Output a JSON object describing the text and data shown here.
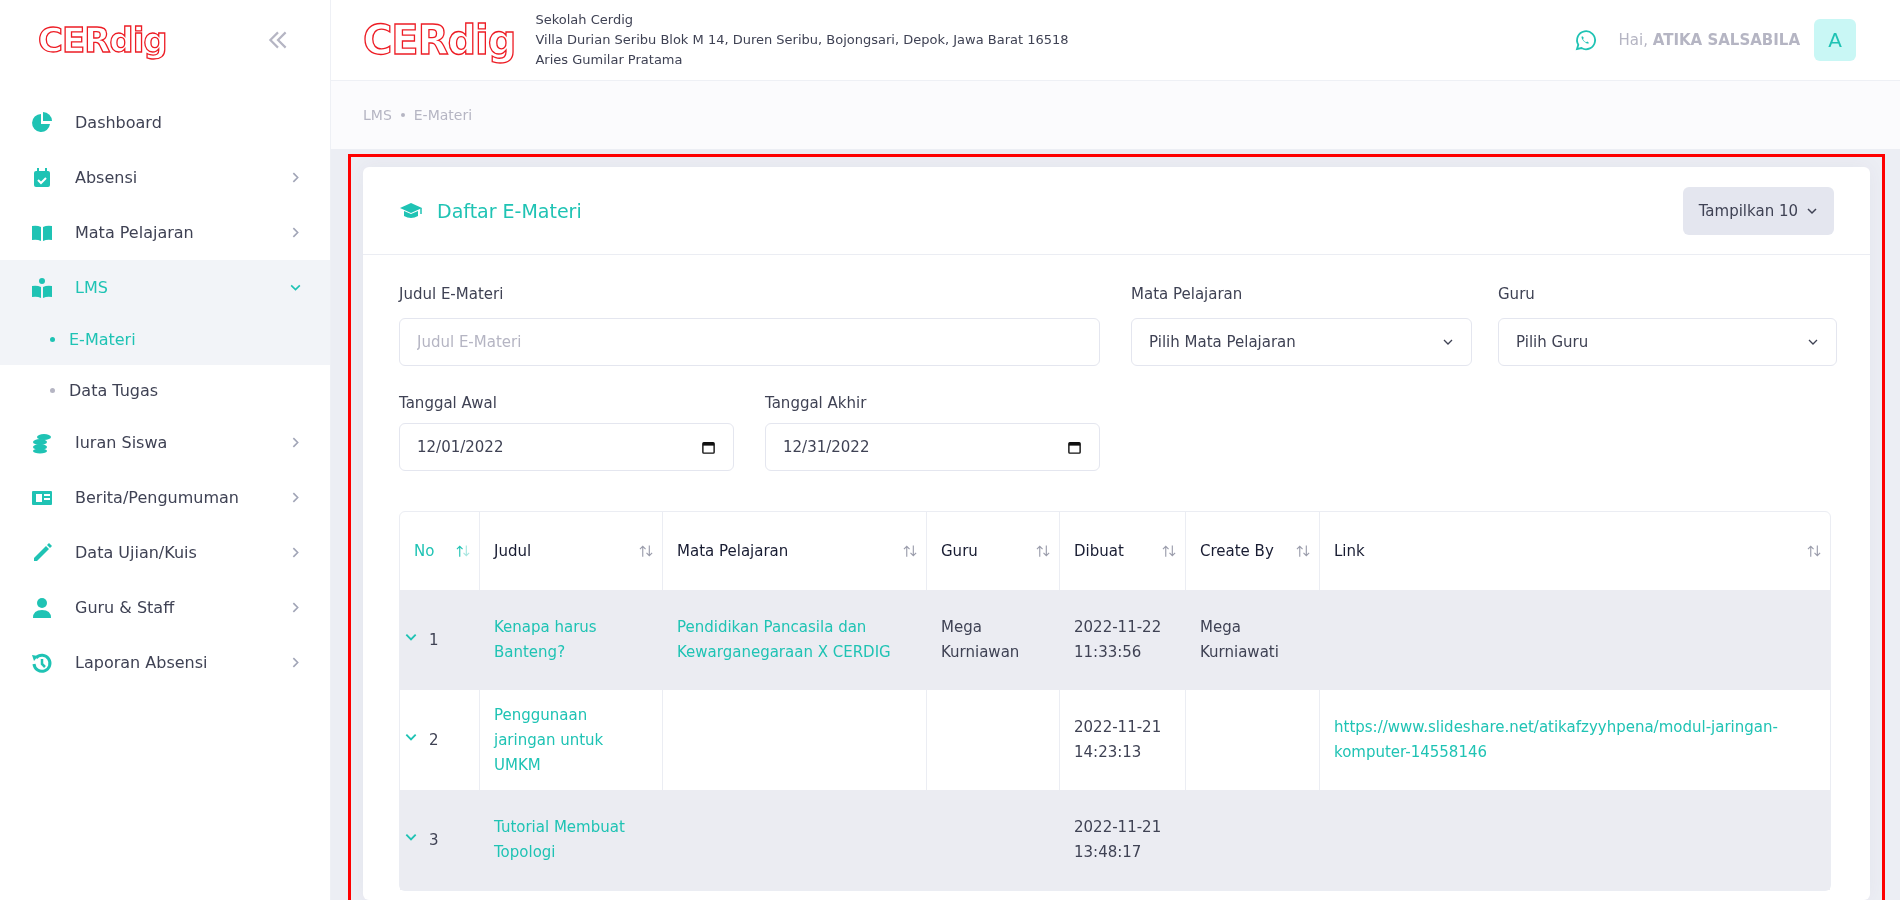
{
  "sidebar": {
    "logo": "CERdig",
    "items": [
      {
        "label": "Dashboard",
        "kind": "link",
        "selected": false
      },
      {
        "label": "Absensi",
        "kind": "group",
        "expanded": false,
        "selected": false
      },
      {
        "label": "Mata Pelajaran",
        "kind": "group",
        "expanded": false,
        "selected": false
      },
      {
        "label": "LMS",
        "kind": "group",
        "expanded": true,
        "selected": true,
        "children": [
          {
            "label": "E-Materi",
            "selected": true
          },
          {
            "label": "Data Tugas",
            "selected": false
          }
        ]
      },
      {
        "label": "Iuran Siswa",
        "kind": "group",
        "expanded": false,
        "selected": false
      },
      {
        "label": "Berita/Pengumuman",
        "kind": "group",
        "expanded": false,
        "selected": false
      },
      {
        "label": "Data Ujian/Kuis",
        "kind": "group",
        "expanded": false,
        "selected": false
      },
      {
        "label": "Guru & Staff",
        "kind": "group",
        "expanded": false,
        "selected": false
      },
      {
        "label": "Laporan Absensi",
        "kind": "group",
        "expanded": false,
        "selected": false
      }
    ]
  },
  "header": {
    "logo": "CERdig",
    "school": "Sekolah Cerdig",
    "address": "Villa Durian Seribu Blok M 14, Duren Seribu, Bojongsari, Depok, Jawa Barat 16518",
    "principal": "Aries Gumilar Pratama",
    "greeting": "Hai, **ATIKA SALSABILA**",
    "avatar": "A"
  },
  "breadcrumb": [
    "LMS",
    "E-Materi"
  ],
  "card": {
    "title": "Daftar E-Materi",
    "page_size_button": "Tampilkan 10",
    "filters": [
      {
        "kind": "text",
        "label": "Judul E-Materi",
        "placeholder": "Judul E-Materi"
      },
      {
        "kind": "select",
        "label": "Mata Pelajaran",
        "value": "Pilih Mata Pelajaran"
      },
      {
        "kind": "select",
        "label": "Guru",
        "value": "Pilih Guru"
      },
      {
        "kind": "date",
        "label": "Tanggal Awal",
        "value": "12/01/2022"
      },
      {
        "kind": "date",
        "label": "Tanggal Akhir",
        "value": "12/31/2022"
      }
    ],
    "table": {
      "columns": [
        {
          "label": "No",
          "sorted": true
        },
        {
          "label": "Judul",
          "sorted": false
        },
        {
          "label": "Mata Pelajaran",
          "sorted": false
        },
        {
          "label": "Guru",
          "sorted": false
        },
        {
          "label": "Dibuat",
          "sorted": false
        },
        {
          "label": "Create By",
          "sorted": false
        },
        {
          "label": "Link",
          "sorted": false
        }
      ],
      "rows": [
        {
          "no": "1",
          "judul": "Kenapa harus Banteng?",
          "mata_pelajaran": "Pendidikan Pancasila dan Kewarganegaraan X CERDIG",
          "guru": "Mega Kurniawan",
          "dibuat": "2022-11-22 11:33:56",
          "create_by": "Mega Kurniawati"
        },
        {
          "no": "2",
          "judul": "Penggunaan jaringan untuk UMKM",
          "dibuat": "2022-11-21 14:23:13",
          "link": "https://www.slideshare.net/atikafzyyhpena/modul-jaringan-komputer-14558146"
        },
        {
          "no": "3",
          "judul": "Tutorial Membuat Topologi",
          "dibuat": "2022-11-21 13:48:17"
        }
      ]
    }
  }
}
